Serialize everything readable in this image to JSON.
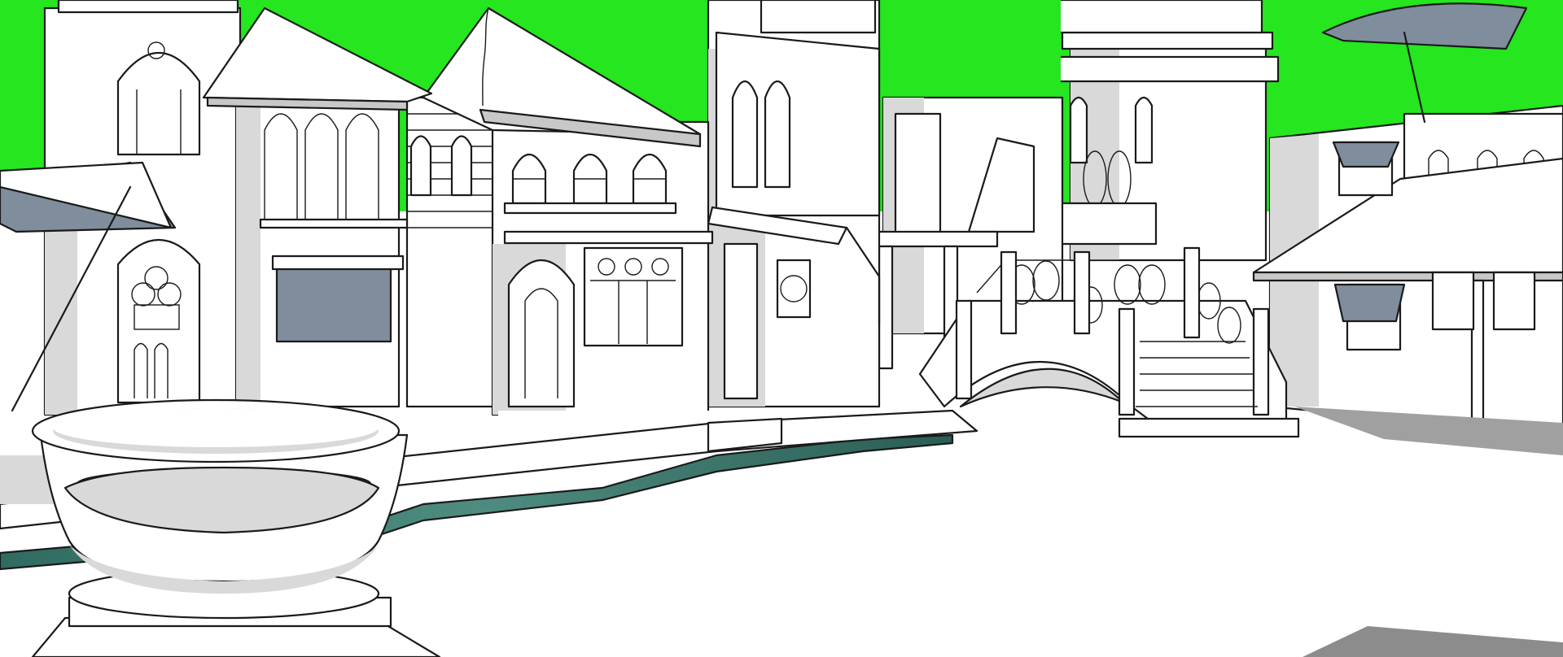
{
  "scene": {
    "colors": {
      "sky_green": "#25e61f",
      "wall": "#ffffff",
      "wall_shadow": "#d9d9d9",
      "canvas_blue_gray": "#7f8d9c",
      "canal_water": "#2e6b5f",
      "outline": "#1a1a1a"
    },
    "elements": [
      "stone-well-basin",
      "canal",
      "arched-footbridge",
      "left-tower-house",
      "tiled-roof-house",
      "gothic-window-house",
      "clock-tower",
      "right-awning-house",
      "market-canopies"
    ]
  }
}
